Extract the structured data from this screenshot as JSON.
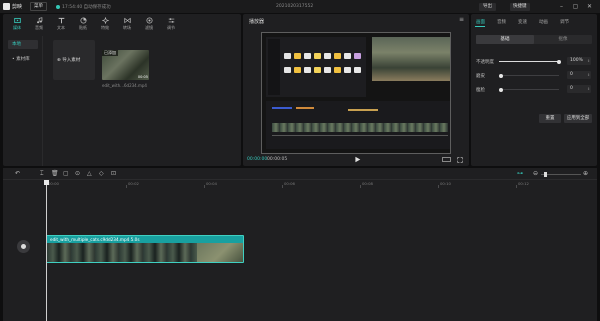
{
  "titlebar": {
    "app_name": "剪映",
    "menu_label": "菜单",
    "autosave_text": "17:54:40 自动保存成功",
    "doc_title": "2021020317552",
    "export_label": "导出",
    "shortcut_label": "快捷键"
  },
  "media_tabs": [
    {
      "label": "媒体",
      "icon": "media-icon",
      "active": true
    },
    {
      "label": "音频",
      "icon": "audio-icon",
      "active": false
    },
    {
      "label": "文本",
      "icon": "text-icon",
      "active": false
    },
    {
      "label": "贴纸",
      "icon": "sticker-icon",
      "active": false
    },
    {
      "label": "特效",
      "icon": "effects-icon",
      "active": false
    },
    {
      "label": "转场",
      "icon": "transition-icon",
      "active": false
    },
    {
      "label": "滤镜",
      "icon": "filter-icon",
      "active": false
    },
    {
      "label": "调节",
      "icon": "adjust-icon",
      "active": false
    }
  ],
  "media_sidebar": [
    {
      "label": "本地",
      "active": true
    },
    {
      "label": "• 素材库",
      "active": false
    }
  ],
  "media": {
    "import_label": "导入素材",
    "clip_added_badge": "已添加",
    "clip_duration": "00:05",
    "clip_name": "edit_with...6d234.mp4"
  },
  "player": {
    "title": "播放器",
    "time_current": "00:00:00",
    "time_total": "00:00:05",
    "ratio_label": "比例"
  },
  "props": {
    "tabs": [
      {
        "label": "画面",
        "active": true
      },
      {
        "label": "音频",
        "active": false
      },
      {
        "label": "变速",
        "active": false
      },
      {
        "label": "动画",
        "active": false
      },
      {
        "label": "调节",
        "active": false
      }
    ],
    "sub_basic": "基础",
    "sub_cutout": "抠像",
    "opacity_label": "不透明度",
    "opacity_value": "100%",
    "opacity_fraction": 1.0,
    "denoise_label": "磨皮",
    "denoise_value": "0",
    "slim_label": "瘦脸",
    "slim_value": "0",
    "reset_label": "重置",
    "apply_all_label": "应用到全部"
  },
  "timeline": {
    "ticks": [
      "00:00",
      "00:02",
      "00:04",
      "00:06",
      "00:08",
      "00:10",
      "00:12"
    ],
    "clip_label": "edit_with_multiple_cats.c9dd234.mp4   5.0s"
  },
  "colors": {
    "accent": "#36c9bb",
    "clip_header": "#18a0a0"
  }
}
